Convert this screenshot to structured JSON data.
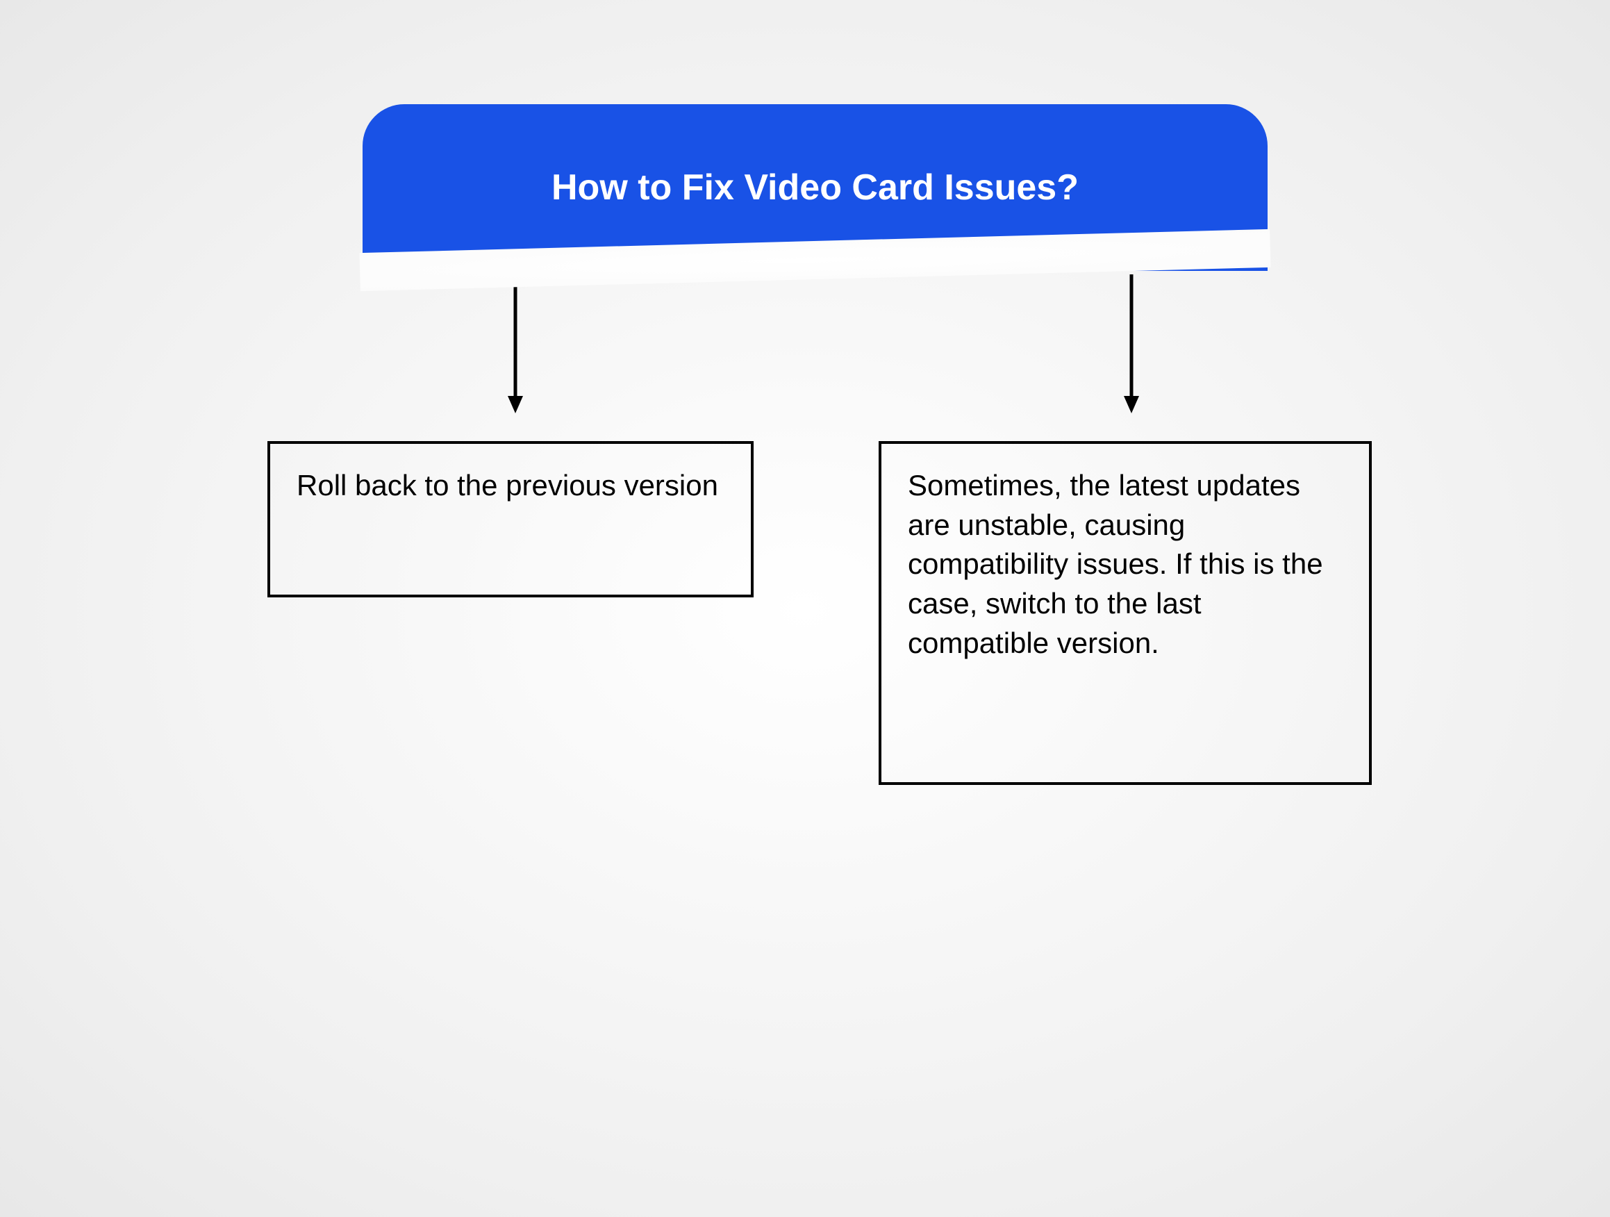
{
  "diagram": {
    "title": "How to Fix Video Card Issues?",
    "left_box": "Roll back to the previous version",
    "right_box": "Sometimes, the latest updates are unstable, causing compatibility issues. If this is the case, switch to the last compatible version."
  }
}
